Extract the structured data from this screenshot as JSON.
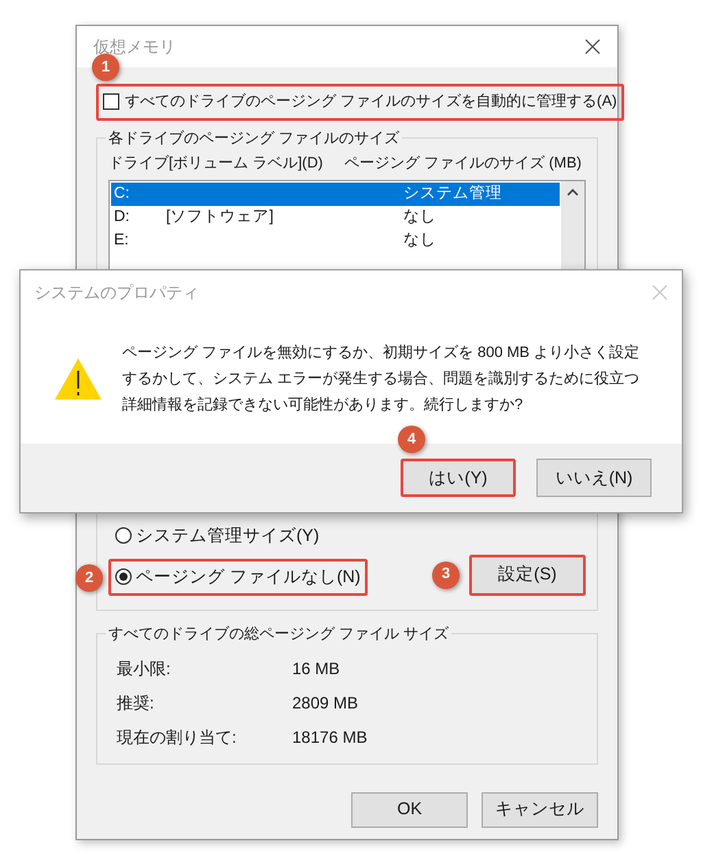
{
  "window": {
    "title": "仮想メモリ"
  },
  "auto_manage": {
    "label": "すべてのドライブのページング ファイルのサイズを自動的に管理する(A)",
    "checked": false,
    "highlighted": true,
    "badge": "1"
  },
  "drive_group": {
    "title": "各ドライブのページング ファイルのサイズ",
    "columns": [
      "ドライブ",
      "[ボリューム ラベル](D)",
      "ページング ファイルのサイズ (MB)"
    ],
    "rows": [
      {
        "drive": "C:",
        "size": "システム管理",
        "selected": true
      },
      {
        "drive": "D:",
        "label": "[ソフトウェア]",
        "size": "なし",
        "selected": false
      },
      {
        "drive": "E:",
        "size": "なし",
        "selected": false
      }
    ]
  },
  "radios": [
    {
      "label": "システム管理サイズ(Y)",
      "selected": false,
      "highlighted": false
    },
    {
      "label": "ページング ファイルなし(N)",
      "selected": true,
      "highlighted": true,
      "badge": "2"
    }
  ],
  "set_button": {
    "label": "設定(S)",
    "highlighted": true,
    "badge": "3"
  },
  "total_group": {
    "title": "すべてのドライブの総ページング ファイル サイズ",
    "rows": [
      {
        "label": "最小限:",
        "value": "16 MB"
      },
      {
        "label": "推奨:",
        "value": "2809 MB"
      },
      {
        "label": "現在の割り当て:",
        "value": "18176 MB"
      }
    ]
  },
  "buttons": [
    {
      "label": "OK"
    },
    {
      "label": "キャンセル"
    }
  ],
  "alert": {
    "title": "システムのプロパティ",
    "message": "ページング ファイルを無効にするか、初期サイズを 800 MB より小さく設定するかして、システム エラーが発生する場合、問題を識別するために役立つ詳細情報を記録できない可能性があります。続行しますか?",
    "buttons": [
      {
        "label": "はい(Y)",
        "highlighted": true,
        "badge": "4"
      },
      {
        "label": "いいえ(N)",
        "highlighted": false
      }
    ]
  }
}
